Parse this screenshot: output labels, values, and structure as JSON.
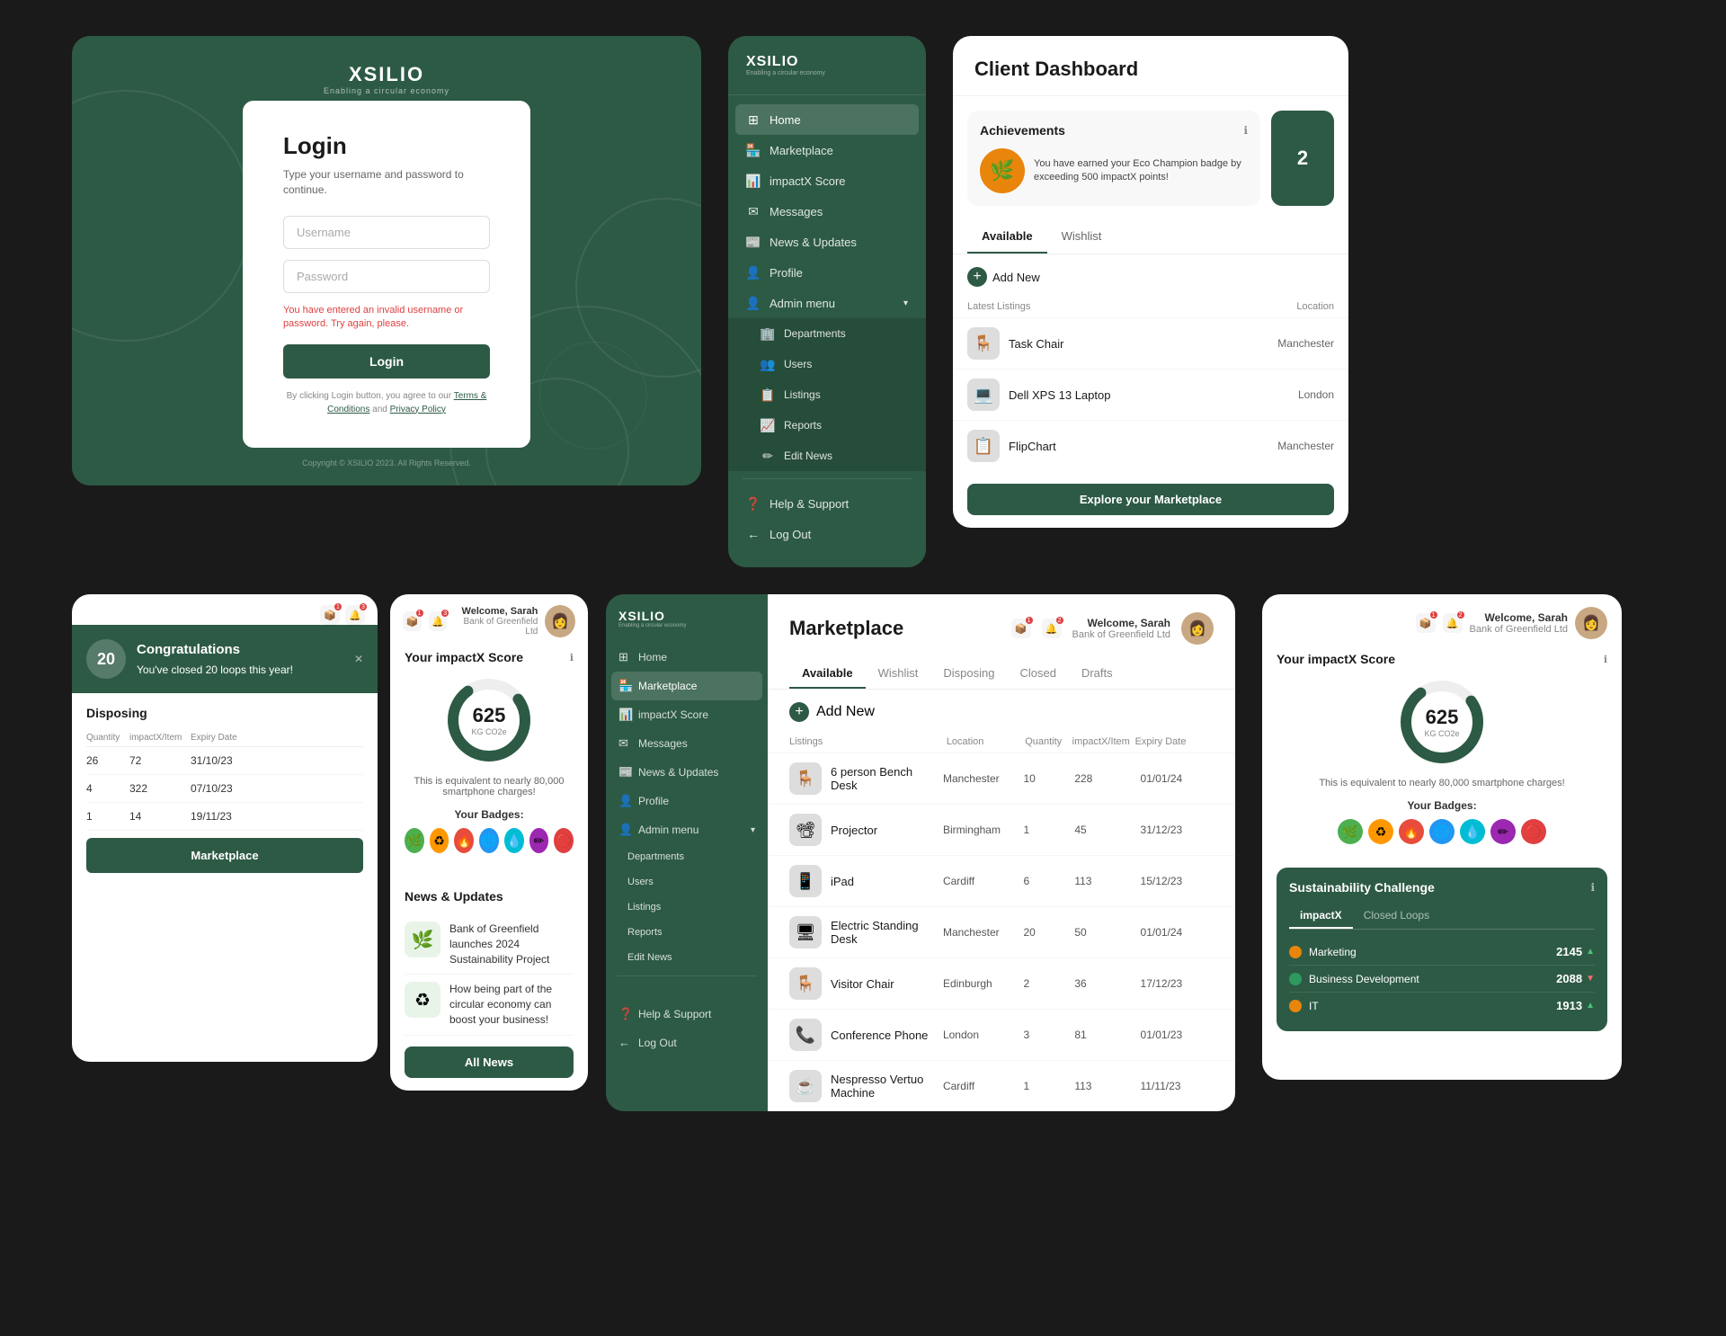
{
  "brand": {
    "name": "XSILIO",
    "tagline": "Enabling a circular economy"
  },
  "login": {
    "title": "Login",
    "subtitle": "Type your username and password to continue.",
    "username_placeholder": "Username",
    "password_placeholder": "Password",
    "error_message": "You have entered an invalid username or password. Try again, please.",
    "button_label": "Login",
    "terms_text": "By clicking Login button, you agree to our",
    "terms_link": "Terms & Conditions",
    "and": "and",
    "privacy_link": "Privacy Policy",
    "copyright": "Copyright © XSILIO 2023. All Rights Reserved."
  },
  "sidebar": {
    "items": [
      {
        "label": "Home",
        "icon": "⊞",
        "active": true
      },
      {
        "label": "Marketplace",
        "icon": "🏪",
        "active": false
      },
      {
        "label": "impactX Score",
        "icon": "📊",
        "active": false
      },
      {
        "label": "Messages",
        "icon": "✉",
        "active": false
      },
      {
        "label": "News & Updates",
        "icon": "📰",
        "active": false
      },
      {
        "label": "Profile",
        "icon": "👤",
        "active": false
      },
      {
        "label": "Admin menu",
        "icon": "👤",
        "active": false,
        "hasChevron": true
      },
      {
        "label": "Departments",
        "icon": "🏢",
        "submenu": true
      },
      {
        "label": "Users",
        "icon": "👥",
        "submenu": true
      },
      {
        "label": "Listings",
        "icon": "📋",
        "submenu": true
      },
      {
        "label": "Reports",
        "icon": "📈",
        "submenu": true
      },
      {
        "label": "Edit News",
        "icon": "✏",
        "submenu": true
      },
      {
        "label": "Help & Support",
        "icon": "❓",
        "bottom": true
      },
      {
        "label": "Log Out",
        "icon": "←",
        "bottom": true
      }
    ]
  },
  "dashboard": {
    "title": "Client Dashboard",
    "achievements": {
      "title": "Achievements",
      "badge_emoji": "🌿",
      "badge_text": "You have earned your Eco Champion badge by exceeding 500 impactX points!"
    },
    "con_value": "2",
    "tabs": [
      "Available",
      "Wishlist"
    ],
    "add_new_label": "Add New",
    "listings_col1": "Latest Listings",
    "listings_col2": "Location",
    "listings": [
      {
        "name": "Task Chair",
        "location": "Manchester",
        "emoji": "🪑"
      },
      {
        "name": "Dell XPS 13 Laptop",
        "location": "London",
        "emoji": "💻"
      },
      {
        "name": "FlipChart",
        "location": "Manchester",
        "emoji": "📋"
      }
    ],
    "explore_btn": "Explore your Marketplace"
  },
  "bottom_left": {
    "notifications": [
      {
        "icon": "📦",
        "badge": "1"
      },
      {
        "icon": "🔔",
        "badge": "3"
      }
    ],
    "congratulations": {
      "title": "Congratulations",
      "value": "20",
      "text": "You've closed 20 loops this year!"
    },
    "disposing_title": "Disposing",
    "table_headers": [
      "Quantity",
      "impactX/Item",
      "Expiry Date"
    ],
    "disposing_rows": [
      {
        "qty": "-",
        "impact": "26",
        "expiry": "72",
        "date": "31/10/23"
      },
      {
        "qty": "-",
        "impact": "4",
        "expiry": "322",
        "date": "07/10/23"
      },
      {
        "qty": "-",
        "impact": "1",
        "expiry": "14",
        "date": "19/11/23"
      }
    ],
    "marketplace_link": "tplace"
  },
  "marketplace_panel": {
    "title": "Marketplace",
    "tabs": [
      "Available",
      "Wishlist",
      "Disposing",
      "Closed",
      "Drafts"
    ],
    "active_tab": "Available",
    "add_new": "Add New",
    "col_listings": "Listings",
    "col_location": "Location",
    "col_quantity": "Quantity",
    "col_impact": "impactX/Item",
    "col_expiry": "Expiry Date",
    "items": [
      {
        "name": "6 person Bench Desk",
        "location": "Manchester",
        "qty": "10",
        "impact": "228",
        "expiry": "01/01/24",
        "emoji": "🪑"
      },
      {
        "name": "Projector",
        "location": "Birmingham",
        "qty": "1",
        "impact": "45",
        "expiry": "31/12/23",
        "emoji": "📽"
      },
      {
        "name": "iPad",
        "location": "Cardiff",
        "qty": "6",
        "impact": "113",
        "expiry": "15/12/23",
        "emoji": "📱"
      },
      {
        "name": "Electric Standing Desk",
        "location": "Manchester",
        "qty": "20",
        "impact": "50",
        "expiry": "01/01/24",
        "emoji": "🖥"
      },
      {
        "name": "Visitor Chair",
        "location": "Edinburgh",
        "qty": "2",
        "impact": "36",
        "expiry": "17/12/23",
        "emoji": "🪑"
      },
      {
        "name": "Conference Phone",
        "location": "London",
        "qty": "3",
        "impact": "81",
        "expiry": "01/01/23",
        "emoji": "📞"
      },
      {
        "name": "Nespresso Vertuo Machine",
        "location": "Cardiff",
        "qty": "1",
        "impact": "113",
        "expiry": "11/11/23",
        "emoji": "☕"
      }
    ]
  },
  "mid_sidebar": {
    "items": [
      {
        "label": "Home",
        "icon": "⊞",
        "active": false
      },
      {
        "label": "Marketplace",
        "icon": "🏪",
        "active": true
      },
      {
        "label": "impactX Score",
        "icon": "📊",
        "active": false
      },
      {
        "label": "Messages",
        "icon": "✉",
        "active": false
      },
      {
        "label": "News & Updates",
        "icon": "📰",
        "active": false
      },
      {
        "label": "Profile",
        "icon": "👤",
        "active": false
      },
      {
        "label": "Admin menu",
        "icon": "👤",
        "active": false,
        "hasChevron": true
      },
      {
        "label": "Departments",
        "icon": "🏢",
        "submenu": true
      },
      {
        "label": "Users",
        "icon": "👥",
        "submenu": true
      },
      {
        "label": "Listings",
        "icon": "📋",
        "submenu": true
      },
      {
        "label": "Reports",
        "icon": "📈",
        "submenu": true
      },
      {
        "label": "Edit News",
        "icon": "✏",
        "submenu": true
      },
      {
        "label": "Help & Support",
        "icon": "❓",
        "bottom": true
      },
      {
        "label": "Log Out",
        "icon": "←",
        "bottom": true
      }
    ]
  },
  "right_panel": {
    "welcome_text": "Welcome, Sarah",
    "company": "Bank of Greenfield Ltd",
    "score_title": "Your impactX Score",
    "score_value": "625",
    "score_unit": "KG CO2e",
    "score_desc": "This is equivalent to nearly 80,000 smartphone charges!",
    "badges_label": "Your Badges:",
    "badges": [
      "🌿",
      "♻",
      "🔥",
      "🌐",
      "💧",
      "✏",
      "🚫"
    ],
    "sustainability": {
      "title": "Sustainability Challenge",
      "tabs": [
        "impactX",
        "Closed Loops"
      ],
      "active_tab": "impactX",
      "rows": [
        {
          "label": "Marketing",
          "value": "2145",
          "trend": "up",
          "color": "#e8850a"
        },
        {
          "label": "Business Development",
          "value": "2088",
          "trend": "down",
          "color": "#2d5a45"
        },
        {
          "label": "IT",
          "value": "1913",
          "trend": "up",
          "color": "#e8850a"
        }
      ]
    }
  },
  "score_panel_left": {
    "welcome_text": "Welcome, Sarah",
    "company": "Bank of Greenfield Ltd",
    "score_title": "Your impactX Score",
    "score_value": "625",
    "score_unit": "KG CO2e",
    "score_desc": "This is equivalent to nearly 80,000 smartphone charges!",
    "badges_label": "Your Badges:"
  },
  "news": {
    "title": "News & Updates",
    "items": [
      {
        "text": "Bank of Greenfield launches 2024 Sustainability Project",
        "emoji": "🌿"
      },
      {
        "text": "How being part of the circular economy can boost your business!",
        "emoji": "♻"
      }
    ],
    "all_news_btn": "All News",
    "all_news_btn2": "All News"
  }
}
